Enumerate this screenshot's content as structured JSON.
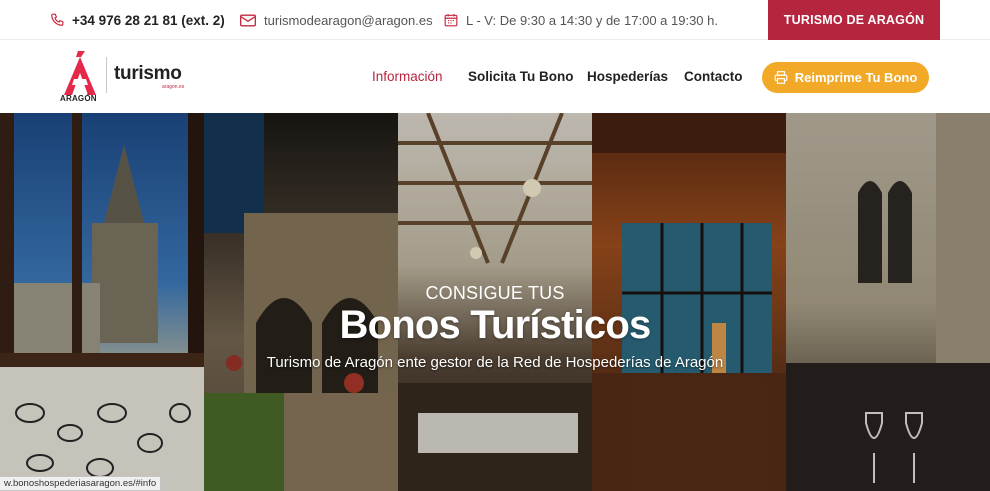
{
  "topbar": {
    "phone": "+34 976 28 21 81 (ext. 2)",
    "email": "turismodearagon@aragon.es",
    "hours": "L - V: De 9:30 a 14:30 y de 17:00 a 19:30 h.",
    "brand_button": "TURISMO DE ARAGÓN"
  },
  "logo": {
    "wordmark": "turismo",
    "tagline": "ARAGÓN",
    "sub": "aragon.es"
  },
  "nav": {
    "items": [
      {
        "label": "Información",
        "active": true
      },
      {
        "label": "Solicita Tu Bono",
        "active": false
      },
      {
        "label": "Hospederías",
        "active": false
      },
      {
        "label": "Contacto",
        "active": false
      }
    ],
    "cta": "Reimprime Tu Bono"
  },
  "hero": {
    "kicker": "CONSIGUE TUS",
    "title": "Bonos Turísticos",
    "subtitle": "Turismo de Aragón ente gestor de la Red de Hospederías de Aragón"
  },
  "status_url": "w.bonoshospederiasaragon.es/#info",
  "colors": {
    "brand_red": "#b5253e",
    "cta_orange": "#f2a928",
    "text_dark": "#222222"
  },
  "icons": {
    "phone": "phone-icon",
    "email": "envelope-icon",
    "hours": "calendar-icon",
    "print": "printer-icon"
  }
}
